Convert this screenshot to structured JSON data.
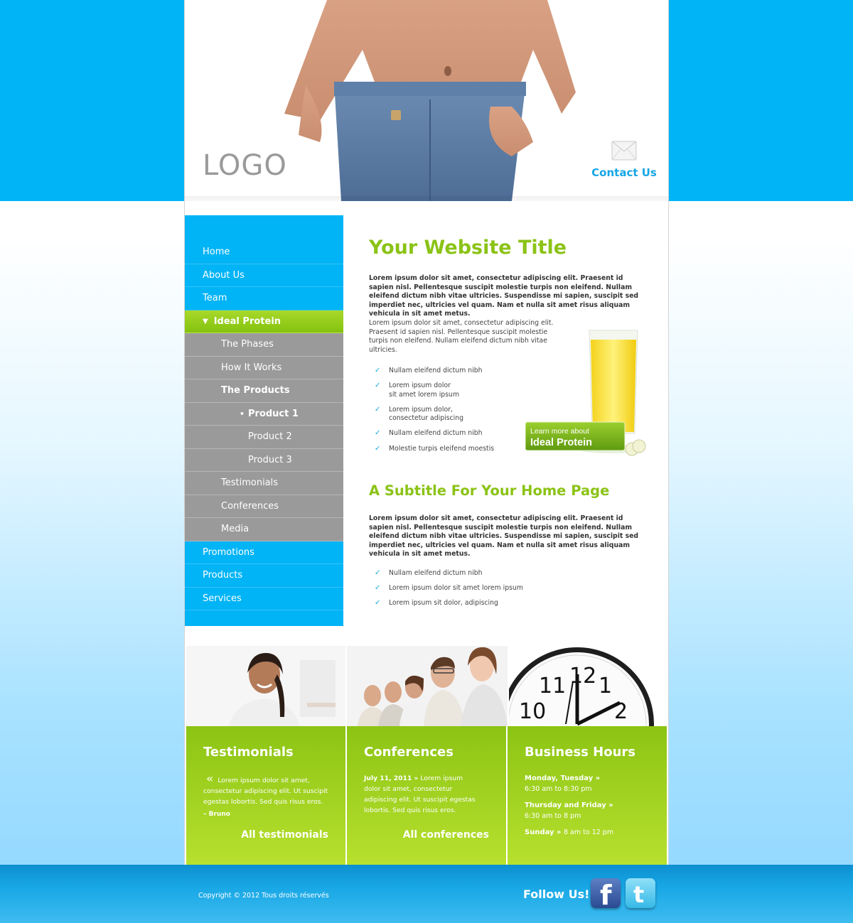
{
  "header": {
    "logo": "LOGO",
    "contact_label": "Contact Us"
  },
  "nav": [
    {
      "label": "Home",
      "level": 0,
      "style": "blue"
    },
    {
      "label": "About Us",
      "level": 0,
      "style": "blue"
    },
    {
      "label": "Team",
      "level": 0,
      "style": "blue"
    },
    {
      "label": "Ideal Protein",
      "level": 0,
      "style": "active"
    },
    {
      "label": "The Phases",
      "level": 1,
      "style": "grey"
    },
    {
      "label": "How It Works",
      "level": 1,
      "style": "grey"
    },
    {
      "label": "The Products",
      "level": 1,
      "style": "grey-bold"
    },
    {
      "label": "Product 1",
      "level": 2,
      "style": "grey-bold-bullet"
    },
    {
      "label": "Product 2",
      "level": 2,
      "style": "grey"
    },
    {
      "label": "Product 3",
      "level": 2,
      "style": "grey"
    },
    {
      "label": "Testimonials",
      "level": 1,
      "style": "grey"
    },
    {
      "label": "Conferences",
      "level": 1,
      "style": "grey"
    },
    {
      "label": "Media",
      "level": 1,
      "style": "grey"
    },
    {
      "label": "Promotions",
      "level": 0,
      "style": "blue"
    },
    {
      "label": "Products",
      "level": 0,
      "style": "blue"
    },
    {
      "label": "Services",
      "level": 0,
      "style": "blue"
    }
  ],
  "main": {
    "title": "Your Website Title",
    "intro_bold": "Lorem ipsum dolor sit amet, consectetur adipiscing elit. Praesent id sapien nisl. Pellentesque suscipit molestie turpis non eleifend. Nullam eleifend dictum nibh vitae ultricies. Suspendisse mi sapien, suscipit sed imperdiet nec, ultricies vel quam. Nam et nulla sit amet risus aliquam vehicula in sit amet metus.",
    "intro_reg": "Lorem ipsum dolor sit amet, consectetur adipiscing elit. Praesent id sapien nisl. Pellentesque suscipit molestie turpis non eleifend. Nullam eleifend dictum nibh vitae ultricies.",
    "list1": [
      [
        "Nullam eleifend dictum nibh"
      ],
      [
        "Lorem ipsum dolor",
        "sit amet lorem ipsum"
      ],
      [
        "Lorem ipsum dolor,",
        "consectetur adipiscing"
      ],
      [
        "Nullam eleifend dictum nibh"
      ],
      [
        "Molestie turpis eleifend moestis"
      ]
    ],
    "promo_line1": "Learn more about",
    "promo_line2": "Ideal Protein",
    "subtitle": "A Subtitle For Your Home Page",
    "body_bold": "Lorem ipsum dolor sit amet, consectetur adipiscing elit. Praesent id sapien nisl. Pellentesque suscipit molestie turpis non eleifend. Nullam eleifend dictum nibh vitae ultricies. Suspendisse mi sapien, suscipit sed imperdiet nec, ultricies vel quam. Nam et nulla sit amet risus aliquam vehicula in sit amet metus.",
    "list2": [
      [
        "Nullam eleifend dictum nibh"
      ],
      [
        "Lorem ipsum dolor sit amet lorem ipsum"
      ],
      [
        "Lorem ipsum sit dolor, adipiscing"
      ]
    ]
  },
  "boxes": {
    "testimonials": {
      "title": "Testimonials",
      "quote": "«",
      "text": "Lorem ipsum dolor sit amet, consectetur adipiscing elit. Ut suscipit egestas lobortis. Sed quis risus eros.",
      "author": "– Bruno",
      "link": "All testimonials"
    },
    "conferences": {
      "title": "Conferences",
      "date": "July 11, 2011 »",
      "text": "Lorem ipsum dolor sit amet, consectetur adipiscing elit. Ut suscipit egestas lobortis. Sed quis risus eros.",
      "link": "All conferences"
    },
    "hours": {
      "title": "Business Hours",
      "day1": "Monday, Tuesday »",
      "time1": "6:30 am to 8:30 pm",
      "day2": "Thursday and Friday »",
      "time2": "6:30 am to 8 pm",
      "day3": "Sunday »",
      "time3": "8 am to 12 pm"
    }
  },
  "footer": {
    "copyright": "Copyright © 2012 Tous droits réservés",
    "follow": "Follow Us!",
    "facebook_glyph": "f",
    "twitter_glyph": "t"
  },
  "colors": {
    "accent_blue": "#00b4f6",
    "accent_green": "#8bc316",
    "grey_nav": "#9a9a9a"
  },
  "clock_numbers": [
    "10",
    "11",
    "12",
    "1",
    "2"
  ]
}
